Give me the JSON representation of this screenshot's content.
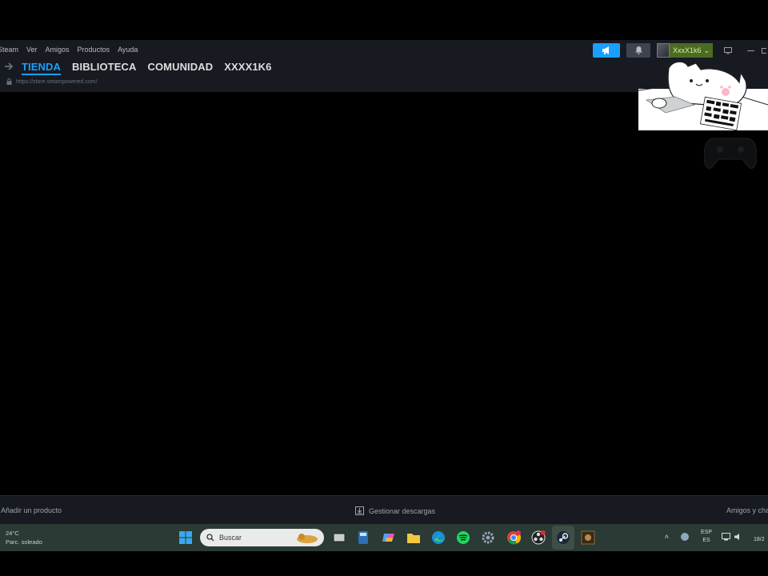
{
  "menu": {
    "items": [
      "Steam",
      "Ver",
      "Amigos",
      "Productos",
      "Ayuda"
    ]
  },
  "account": {
    "username": "XxxX1k6",
    "caret": "⌄"
  },
  "nav": {
    "back_icon": "arrow-right-icon",
    "tabs": [
      {
        "label": "TIENDA",
        "active": true
      },
      {
        "label": "BIBLIOTECA",
        "active": false
      },
      {
        "label": "COMUNIDAD",
        "active": false
      },
      {
        "label": "XXXX1K6",
        "active": false
      }
    ],
    "url": "https://store.steampowered.com/"
  },
  "bottombar": {
    "add_product": "Añadir un producto",
    "downloads": "Gestionar descargas",
    "friends": "Amigos y cha"
  },
  "taskbar": {
    "weather_temp": "24°C",
    "weather_desc": "Parc. soleado",
    "search_placeholder": "Buscar",
    "lang_top": "ESP",
    "lang_bottom": "ES",
    "date": "18/2"
  },
  "colors": {
    "accent": "#1a9fff",
    "user_bg": "#4c6b22",
    "user_text": "#d2efa9",
    "chrome": "#171a21",
    "taskbar": "#2b3a34"
  }
}
